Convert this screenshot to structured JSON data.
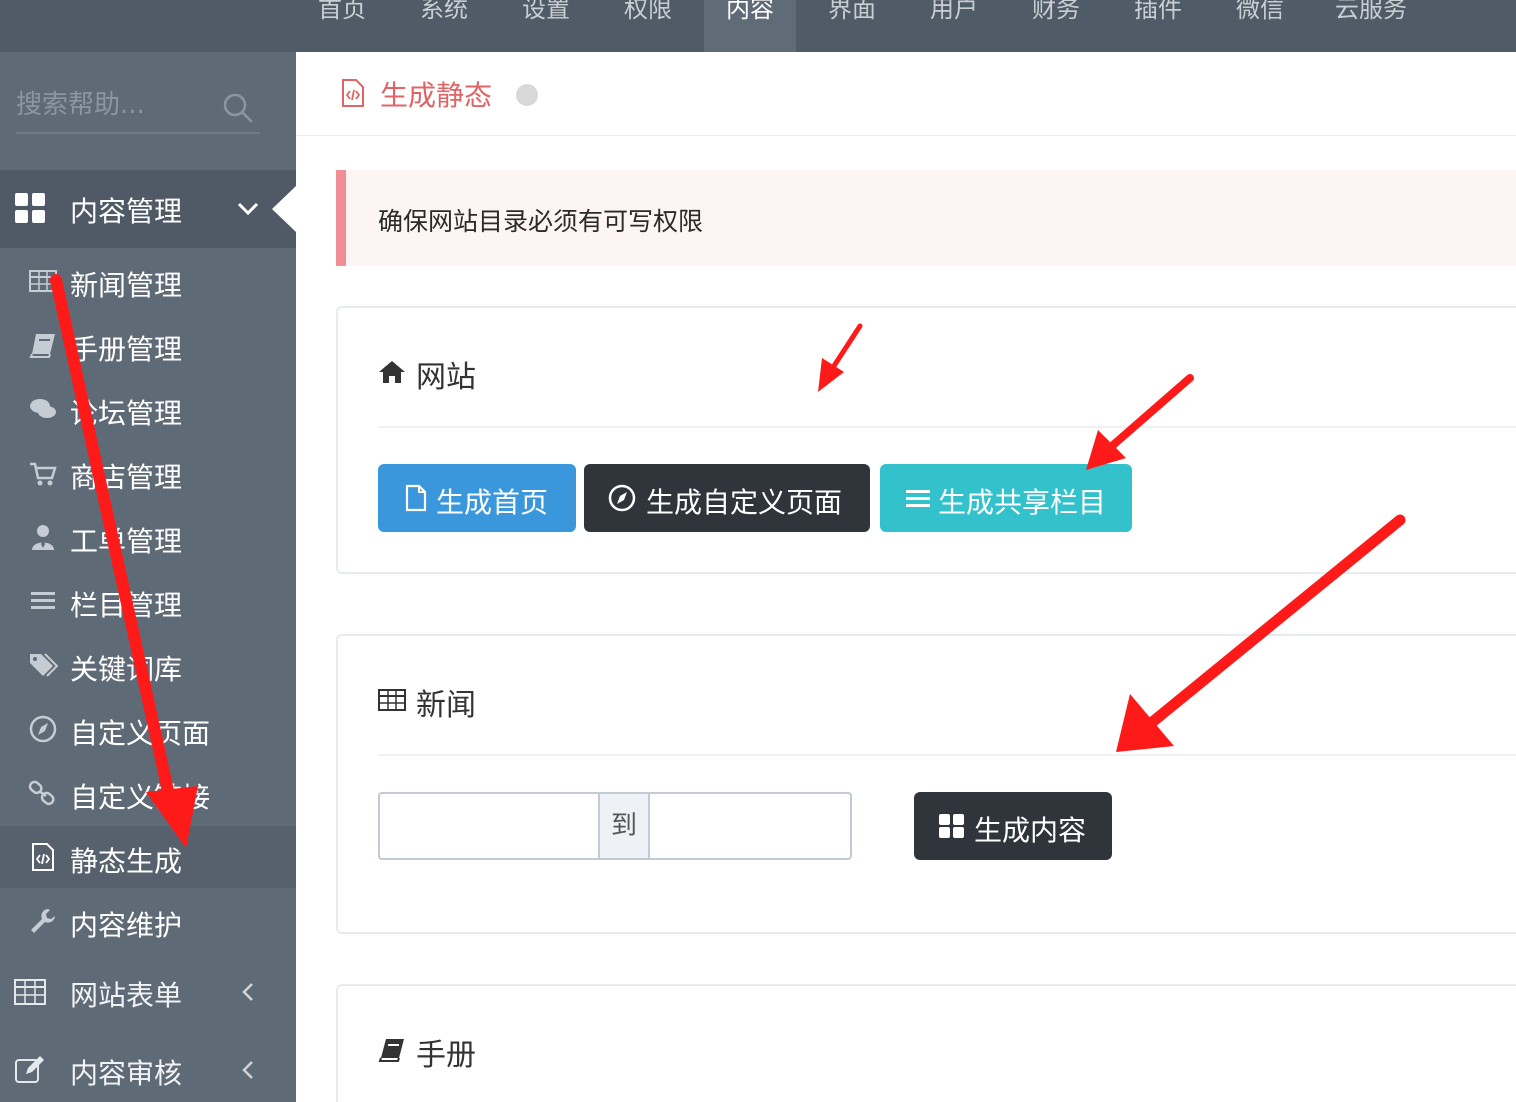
{
  "topnav": {
    "items": [
      {
        "label": "首页",
        "active": false
      },
      {
        "label": "系统",
        "active": false
      },
      {
        "label": "设置",
        "active": false
      },
      {
        "label": "权限",
        "active": false
      },
      {
        "label": "内容",
        "active": true
      },
      {
        "label": "界面",
        "active": false
      },
      {
        "label": "用户",
        "active": false
      },
      {
        "label": "财务",
        "active": false
      },
      {
        "label": "插件",
        "active": false
      },
      {
        "label": "微信",
        "active": false
      },
      {
        "label": "云服务",
        "active": false
      }
    ]
  },
  "sidebar": {
    "search": {
      "placeholder": "搜索帮助...",
      "icon": "search-icon"
    },
    "group_expanded": {
      "label": "内容管理",
      "icon": "grid-icon"
    },
    "items": [
      {
        "label": "新闻管理",
        "icon": "table-icon",
        "active": false
      },
      {
        "label": "手册管理",
        "icon": "book-icon",
        "active": false
      },
      {
        "label": "论坛管理",
        "icon": "comments-icon",
        "active": false
      },
      {
        "label": "商店管理",
        "icon": "cart-icon",
        "active": false
      },
      {
        "label": "工单管理",
        "icon": "user-tie-icon",
        "active": false
      },
      {
        "label": "栏目管理",
        "icon": "bars-icon",
        "active": false
      },
      {
        "label": "关键词库",
        "icon": "tags-icon",
        "active": false
      },
      {
        "label": "自定义页面",
        "icon": "compass-icon",
        "active": false
      },
      {
        "label": "自定义链接",
        "icon": "link-icon",
        "active": false
      },
      {
        "label": "静态生成",
        "icon": "file-code-icon",
        "active": true
      },
      {
        "label": "内容维护",
        "icon": "wrench-icon",
        "active": false
      }
    ],
    "groups_collapsed": [
      {
        "label": "网站表单",
        "icon": "table-icon"
      },
      {
        "label": "内容审核",
        "icon": "edit-icon"
      }
    ]
  },
  "page": {
    "title": "生成静态",
    "alert": "确保网站目录必须有可写权限"
  },
  "sections": {
    "site": {
      "title": "网站",
      "buttons": {
        "home": "生成首页",
        "custom_page": "生成自定义页面",
        "shared_column": "生成共享栏目"
      }
    },
    "news": {
      "title": "新闻",
      "range_sep": "到",
      "from_value": "",
      "to_value": "",
      "generate": "生成内容"
    },
    "manual": {
      "title": "手册"
    }
  },
  "colors": {
    "topnav_bg": "#4f5b66",
    "sidebar_bg": "#5f6a77",
    "accent_red": "#e06464",
    "btn_blue": "#3a97dc",
    "btn_dark": "#2f353b",
    "btn_cyan": "#33c2cc",
    "annotation_red": "#ff1a1a"
  }
}
